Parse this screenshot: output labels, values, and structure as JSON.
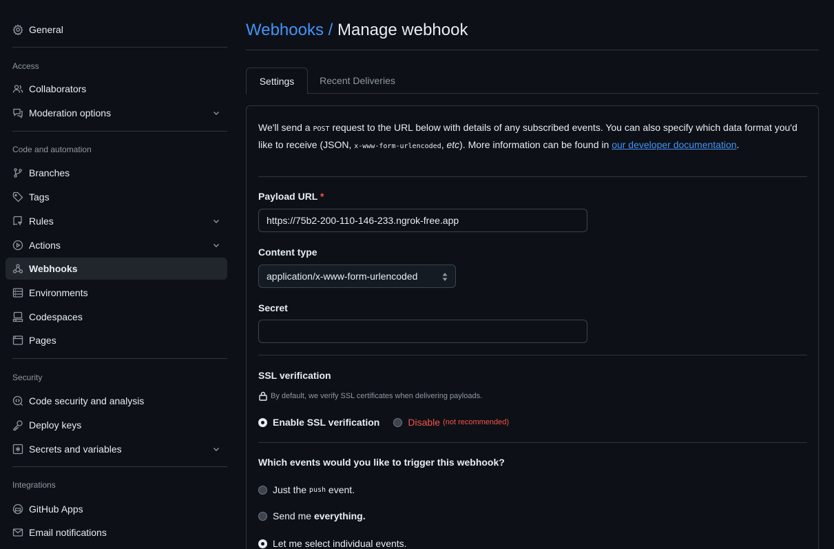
{
  "sidebar": {
    "general": "General",
    "sections": {
      "access": "Access",
      "code_automation": "Code and automation",
      "security": "Security",
      "integrations": "Integrations"
    },
    "items": {
      "collaborators": "Collaborators",
      "moderation": "Moderation options",
      "branches": "Branches",
      "tags": "Tags",
      "rules": "Rules",
      "actions": "Actions",
      "webhooks": "Webhooks",
      "environments": "Environments",
      "codespaces": "Codespaces",
      "pages": "Pages",
      "code_security": "Code security and analysis",
      "deploy_keys": "Deploy keys",
      "secrets": "Secrets and variables",
      "github_apps": "GitHub Apps",
      "email_notifications": "Email notifications"
    },
    "active_item": "webhooks"
  },
  "header": {
    "crumb": "Webhooks",
    "separator": " / ",
    "title": "Manage webhook"
  },
  "tabs": {
    "settings": "Settings",
    "recent_deliveries": "Recent Deliveries",
    "active": "settings"
  },
  "intro": {
    "part1": "We'll send a ",
    "code1": "POST",
    "part2": " request to the URL below with details of any subscribed events. You can also specify which data format you'd like to receive (JSON, ",
    "code2": "x-www-form-urlencoded",
    "part3": ", ",
    "em": "etc",
    "part4": "). More information can be found in ",
    "link": "our developer documentation",
    "part5": "."
  },
  "form": {
    "payload_label": "Payload URL",
    "required_mark": "*",
    "payload_value": "https://75b2-200-110-146-233.ngrok-free.app",
    "content_type_label": "Content type",
    "content_type_value": "application/x-www-form-urlencoded",
    "secret_label": "Secret",
    "secret_value": ""
  },
  "ssl": {
    "label": "SSL verification",
    "note": "By default, we verify SSL certificates when delivering payloads.",
    "enable": "Enable SSL verification",
    "disable": "Disable",
    "disable_note": "(not recommended)",
    "selected": "enable"
  },
  "events": {
    "question": "Which events would you like to trigger this webhook?",
    "opt1_pre": "Just the ",
    "opt1_code": "push",
    "opt1_post": " event.",
    "opt2_pre": "Send me ",
    "opt2_bold": "everything.",
    "opt3": "Let me select individual events.",
    "selected": "individual"
  },
  "colors": {
    "background": "#0d1117",
    "link": "#4493f8",
    "danger": "#f85149",
    "border": "#30363d"
  }
}
